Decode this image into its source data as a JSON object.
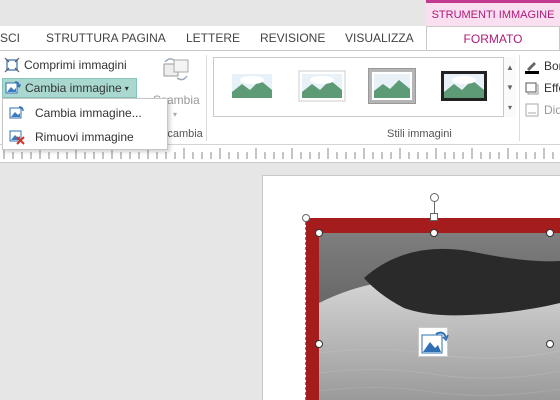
{
  "context_header": {
    "label": "STRUMENTI IMMAGINE"
  },
  "tabs": [
    {
      "label": "SCI"
    },
    {
      "label": "STRUTTURA PAGINA"
    },
    {
      "label": "LETTERE"
    },
    {
      "label": "REVISIONE"
    },
    {
      "label": "VISUALIZZA"
    },
    {
      "label": "FORMATO"
    }
  ],
  "ribbon": {
    "compress_label": "Comprimi immagini",
    "change_label": "Cambia immagine",
    "swap_label": "Scambia",
    "swap_group_label": "Scambia",
    "styles_group_label": "Stili immagini",
    "right_buttons": [
      {
        "label": "Bor"
      },
      {
        "label": "Effe"
      },
      {
        "label": "Did"
      }
    ]
  },
  "menu": {
    "items": [
      {
        "label": "Cambia immagine..."
      },
      {
        "label": "Rimuovi immagine"
      }
    ]
  },
  "colors": {
    "accent": "#b01a7a",
    "frame_red": "#a51c1c",
    "selection_teal": "#a8d8d0"
  }
}
